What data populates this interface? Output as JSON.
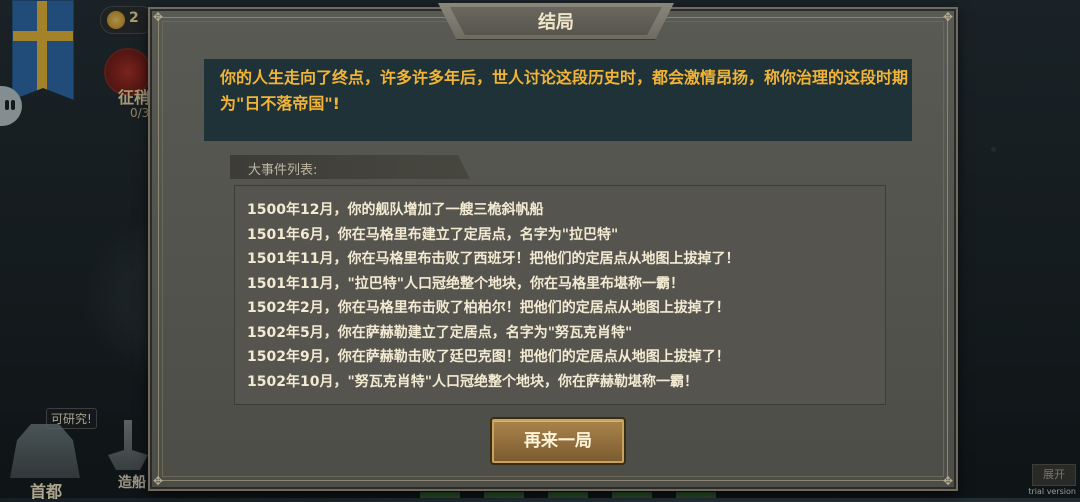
{
  "background": {
    "coin_value": "2",
    "conquer_label": "征稍",
    "conquer_count": "0/3",
    "research_tip": "可研究!",
    "capital_label": "首都",
    "shipyard_label": "造船",
    "expand_label": "展开",
    "trial_label": "trial version"
  },
  "modal": {
    "title": "结局",
    "ending_text": "你的人生走向了终点，许多许多年后，世人讨论这段历史时，都会激情昂扬，称你治理的这段时期为\"日不落帝国\"!",
    "events_title": "大事件列表:",
    "events": [
      "1500年12月，你的舰队增加了一艘三桅斜帆船",
      "1501年6月，你在马格里布建立了定居点，名字为\"拉巴特\"",
      "1501年11月，你在马格里布击败了西班牙！把他们的定居点从地图上拔掉了！",
      "1501年11月，\"拉巴特\"人口冠绝整个地块，你在马格里布堪称一霸！",
      "1502年2月，你在马格里布击败了柏柏尔！把他们的定居点从地图上拔掉了！",
      "1502年5月，你在萨赫勒建立了定居点，名字为\"努瓦克肖特\"",
      "1502年9月，你在萨赫勒击败了廷巴克图！把他们的定居点从地图上拔掉了！",
      "1502年10月，\"努瓦克肖特\"人口冠绝整个地块，你在萨赫勒堪称一霸！"
    ],
    "restart_label": "再来一局"
  },
  "colors": {
    "ending_text": "#f1b436",
    "event_text": "#f2ead2",
    "button": "#a9834b"
  }
}
